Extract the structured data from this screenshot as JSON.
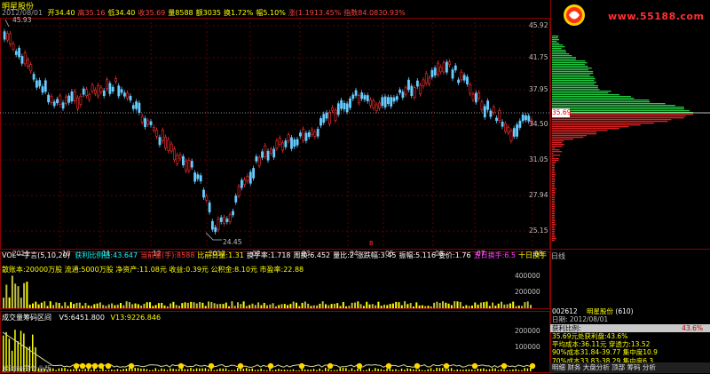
{
  "stock": {
    "name": "明星股份",
    "date": "2012/08/01"
  },
  "quote_bar": [
    {
      "label": "开34.40",
      "color": "yellow"
    },
    {
      "label": "高35.16",
      "color": "red"
    },
    {
      "label": "低34.40",
      "color": "yellow"
    },
    {
      "label": "收35.69",
      "color": "red"
    },
    {
      "label": "量8588",
      "color": "yellow"
    },
    {
      "label": "额3035",
      "color": "yellow"
    },
    {
      "label": "换1.72%",
      "color": "yellow"
    },
    {
      "label": "幅5.10%",
      "color": "yellow"
    },
    {
      "label": "涨(1.1913.45%",
      "color": "red"
    },
    {
      "label": "指数84.0830.93%",
      "color": "red"
    }
  ],
  "main_chart": {
    "max_label": "45.93",
    "min_label": "24.45",
    "price_levels": [
      "45.92",
      "41.75",
      "37.95",
      "34.50",
      "31.05",
      "27.94",
      "25.15"
    ],
    "current_price": "35.69",
    "x_labels": [
      "2011",
      "10",
      "11",
      "12",
      "2012",
      "02",
      "03",
      "04",
      "05",
      "06",
      "07",
      "08"
    ],
    "signal_marker": "B"
  },
  "volume": {
    "header": "VOL一字言(5,10,20)",
    "items": [
      {
        "label": "获利比例值:43.647",
        "color": "cyan"
      },
      {
        "label": "当前量(手):8588",
        "color": "red"
      },
      {
        "label": "比前日量:1.31",
        "color": "yellow"
      },
      {
        "label": "换手率:1.718",
        "color": "white"
      },
      {
        "label": "周换:6.452",
        "color": "white"
      },
      {
        "label": "量比:2",
        "color": "white"
      },
      {
        "label": "涨跌幅:3.45",
        "color": "white"
      },
      {
        "label": "振幅:5.116",
        "color": "white"
      },
      {
        "label": "委价:1.76",
        "color": "white"
      },
      {
        "label": "五日换手:6.5",
        "color": "magenta"
      },
      {
        "label": "十日换手",
        "color": "yellow"
      }
    ],
    "fundamentals": "散账本:20000万股  流通:5000万股  净资产:11.08元  收益:0.39元  公积金:8.10元  市盈率:22.88",
    "axis": [
      "400000",
      "200000"
    ]
  },
  "lower": {
    "header": "成交量筹码区间",
    "v5": "V5:6451.800",
    "v13": "V13:9226.846",
    "axis": [
      "200000",
      "100000"
    ]
  },
  "footer_left": "股海精灵专业版",
  "right_panel": {
    "logo_text": "www.55188.com",
    "day_tab": "日线",
    "info_header_code": "002612",
    "info_header_name": "明星股份",
    "info_header_num": "(610)",
    "rows": [
      "日期: 2012/08/01",
      "获利比例:",
      "35.69元处获利盘:43.6%",
      "平均成本:36.11元 穿透力:13.52",
      "90%成本31.84-39.77 集中度10.9",
      "70%成本33.83-38.29 集中度6.3"
    ],
    "profit_ratio": "43.6%",
    "bottom_tabs": "明细 财务 大盘分析 顶部 筹码 分析"
  }
}
